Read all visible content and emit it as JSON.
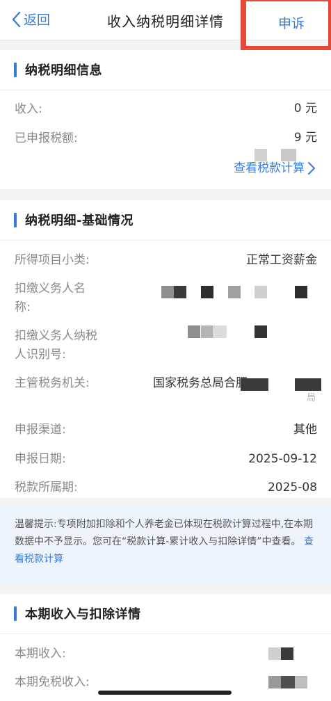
{
  "nav": {
    "back_label": "返回",
    "title": "收入纳税明细详情",
    "appeal_label": "申诉"
  },
  "section1": {
    "title": "纳税明细信息",
    "income_label": "收入:",
    "income_value_tail": "0 元",
    "tax_label": "已申报税额:",
    "tax_value_tail": "9 元",
    "calc_link": "查看税款计算"
  },
  "section2": {
    "title": "纳税明细-基础情况",
    "rows": [
      {
        "label": "所得项目小类:",
        "value": "正常工资薪金"
      },
      {
        "label": "扣缴义务人名称:",
        "value": ""
      },
      {
        "label": "扣缴义务人纳税人识别号:",
        "value": ""
      },
      {
        "label": "主管税务机关:",
        "value": "国家税务总局合肥"
      },
      {
        "label": "申报渠道:",
        "value": "其他"
      },
      {
        "label": "申报日期:",
        "value": "2025-09-12"
      },
      {
        "label": "税款所属期:",
        "value": "2025-08"
      }
    ],
    "agent_name_label_line1": "扣缴义务人名",
    "agent_name_label_line2": "称:",
    "agent_id_label_line1": "扣缴义务人纳税",
    "agent_id_label_line2": "人识别号:",
    "tax_office_tail": "局"
  },
  "tip": {
    "text": "温馨提示:专项附加扣除和个人养老金已体现在税款计算过程中,在本期数据中不予显示。您可在“税款计算-累计收入与扣除详情”中查看。",
    "link": "查看税款计算"
  },
  "section3": {
    "title": "本期收入与扣除详情",
    "current_income_label": "本期收入:",
    "tax_free_income_label": "本期免税收入:"
  },
  "colors": {
    "accent": "#3b7bd8",
    "highlight_box": "#e34a3a"
  }
}
